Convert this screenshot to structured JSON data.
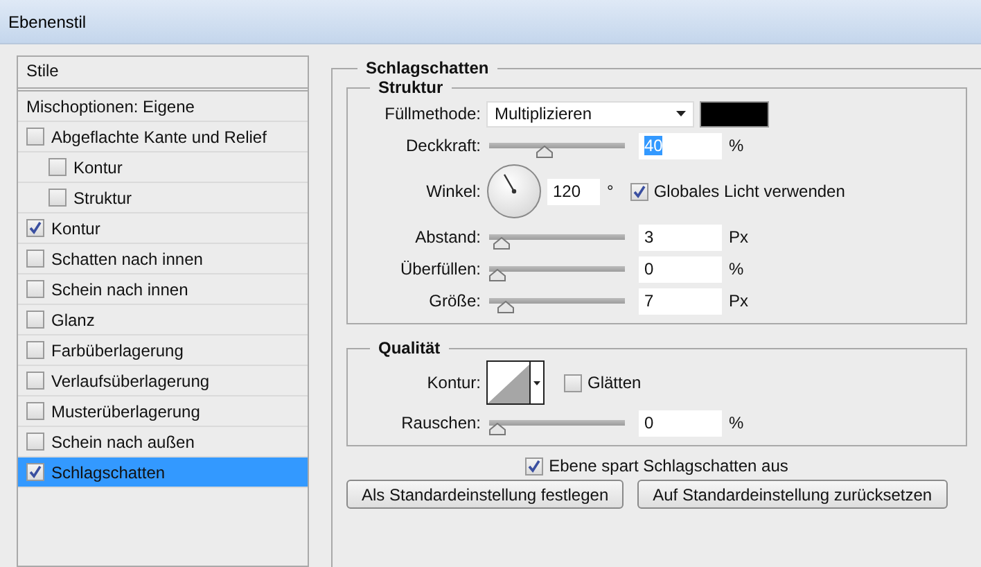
{
  "window": {
    "title": "Ebenenstil"
  },
  "styles_panel": {
    "header": "Stile",
    "blend_options": "Mischoptionen: Eigene",
    "items": [
      {
        "label": "Abgeflachte Kante und Relief",
        "checked": false,
        "selected": false,
        "children": [
          {
            "label": "Kontur",
            "checked": false,
            "selected": false
          },
          {
            "label": "Struktur",
            "checked": false,
            "selected": false
          }
        ]
      },
      {
        "label": "Kontur",
        "checked": true,
        "selected": false
      },
      {
        "label": "Schatten nach innen",
        "checked": false,
        "selected": false
      },
      {
        "label": "Schein nach innen",
        "checked": false,
        "selected": false
      },
      {
        "label": "Glanz",
        "checked": false,
        "selected": false
      },
      {
        "label": "Farbüberlagerung",
        "checked": false,
        "selected": false
      },
      {
        "label": "Verlaufsüberlagerung",
        "checked": false,
        "selected": false
      },
      {
        "label": "Musterüberlagerung",
        "checked": false,
        "selected": false
      },
      {
        "label": "Schein nach außen",
        "checked": false,
        "selected": false
      },
      {
        "label": "Schlagschatten",
        "checked": true,
        "selected": true
      }
    ]
  },
  "effect": {
    "title": "Schlagschatten",
    "structure": {
      "title": "Struktur",
      "blend_mode": {
        "label": "Füllmethode:",
        "value": "Multiplizieren",
        "color": "#000000"
      },
      "rows": [
        {
          "kind": "slider",
          "label": "Deckkraft:",
          "level": 0.4,
          "value": "40",
          "unit": "%",
          "highlighted": true
        },
        {
          "kind": "angle",
          "label": "Winkel:",
          "value": "120",
          "unit": "°",
          "global_light": {
            "label": "Globales Licht verwenden",
            "checked": true
          }
        },
        {
          "kind": "slider",
          "label": "Abstand:",
          "level": 0.03,
          "value": "3",
          "unit": "Px",
          "highlighted": false
        },
        {
          "kind": "slider",
          "label": "Überfüllen:",
          "level": 0,
          "value": "0",
          "unit": "%",
          "highlighted": false
        },
        {
          "kind": "slider",
          "label": "Größe:",
          "level": 0.07,
          "value": "7",
          "unit": "Px",
          "highlighted": false
        }
      ]
    },
    "quality": {
      "title": "Qualität",
      "contour": {
        "label": "Kontur:"
      },
      "anti_alias": {
        "label": "Glätten",
        "checked": false
      },
      "noise": {
        "label": "Rauschen:",
        "level": 0,
        "value": "0",
        "unit": "%"
      }
    },
    "knockout": {
      "label": "Ebene spart Schlagschatten aus",
      "checked": true
    },
    "buttons": [
      "Als Standardeinstellung festlegen",
      "Auf Standardeinstellung zurücksetzen"
    ]
  }
}
